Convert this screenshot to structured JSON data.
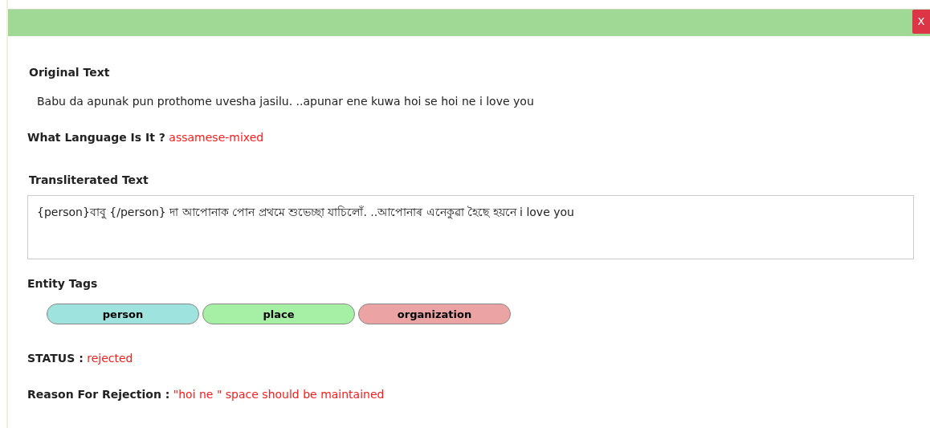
{
  "close_button": "X",
  "original_text": {
    "label": "Original Text",
    "value": "Babu da apunak pun prothome uvesha jasilu. ..apunar ene kuwa hoi se hoi ne i love you"
  },
  "language": {
    "label": "What Language Is It ?",
    "value": "assamese-mixed"
  },
  "transliterated_text": {
    "label": "Transliterated Text",
    "value": "{person}বাবু {/person} দা আপোনাক পোন প্ৰথমে শুভেচ্ছা যাচিলোঁ. ..আপোনাৰ এনেকুৱা হৈছে হয়নে i love you"
  },
  "entity_tags": {
    "label": "Entity Tags",
    "tags": [
      {
        "label": "person",
        "color": "#9fe3df"
      },
      {
        "label": "place",
        "color": "#a6f0a6"
      },
      {
        "label": "organization",
        "color": "#eba3a3"
      }
    ]
  },
  "status": {
    "label": "STATUS :",
    "value": "rejected"
  },
  "rejection_reason": {
    "label": "Reason For Rejection :",
    "value": "\"hoi ne \" space should be maintained"
  }
}
